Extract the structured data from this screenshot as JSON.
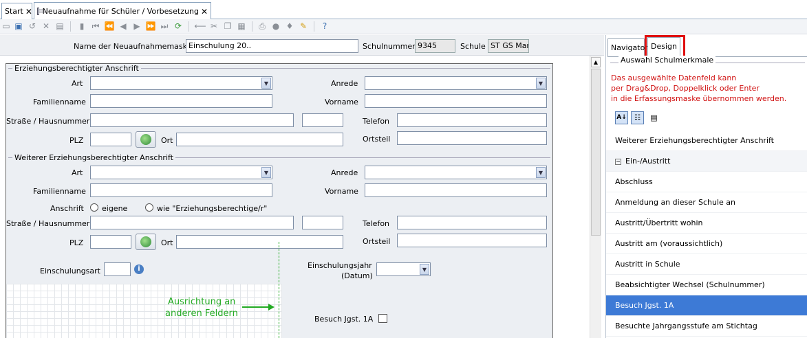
{
  "tabs": [
    {
      "label": "Start"
    },
    {
      "label": "Neuaufnahme für Schüler / Vorbesetzung"
    }
  ],
  "close_glyph": "✕",
  "header": {
    "name_label": "Name der Neuaufnahmemaske",
    "name_value": "Einschulung 20..",
    "schulnummer_label": "Schulnummer",
    "schulnummer_value": "9345",
    "schule_label": "Schule",
    "schule_value": "ST GS Mark"
  },
  "group1": {
    "title": "Erziehungsberechtigter Anschrift",
    "art": "Art",
    "anrede": "Anrede",
    "familienname": "Familienname",
    "vorname": "Vorname",
    "strasse": "Straße / Hausnummer",
    "telefon": "Telefon",
    "plz": "PLZ",
    "ort": "Ort",
    "ortsteil": "Ortsteil"
  },
  "group2": {
    "title": "Weiterer Erziehungsberechtigter Anschrift",
    "art": "Art",
    "anrede": "Anrede",
    "familienname": "Familienname",
    "vorname": "Vorname",
    "anschrift": "Anschrift",
    "opt1": "eigene",
    "opt2": "wie \"Erziehungsberechtige/r\"",
    "strasse": "Straße / Hausnummer",
    "telefon": "Telefon",
    "plz": "PLZ",
    "ort": "Ort",
    "ortsteil": "Ortsteil"
  },
  "einschulungsart": "Einschulungsart",
  "einschulungsjahr_l1": "Einschulungsjahr",
  "einschulungsjahr_l2": "(Datum)",
  "annotation_l1": "Ausrichtung an",
  "annotation_l2": "anderen Feldern",
  "besuch_label": "Besuch Jgst. 1A",
  "right": {
    "tab_navigator": "Navigator",
    "tab_design": "Design",
    "section": "Auswahl Schulmerkmale",
    "hint_l1": "Das ausgewählte Datenfeld kann",
    "hint_l2": "per Drag&Drop, Doppelklick oder Enter",
    "hint_l3": "in die Erfassungsmaske übernommen werden.",
    "items": [
      {
        "label": "Weiterer Erziehungsberechtigter Anschrift"
      },
      {
        "label": "Ein-/Austritt",
        "group": true
      },
      {
        "label": "Abschluss"
      },
      {
        "label": "Anmeldung an dieser Schule an"
      },
      {
        "label": "Austritt/Übertritt wohin"
      },
      {
        "label": "Austritt am (voraussichtlich)"
      },
      {
        "label": "Austritt in Schule"
      },
      {
        "label": "Beabsichtigter Wechsel (Schulnummer)"
      },
      {
        "label": "Besuch Jgst. 1A",
        "selected": true
      },
      {
        "label": "Besuchte Jahrgangsstufe am Stichtag"
      }
    ]
  },
  "colors": {
    "accent": "#3d7ad6",
    "hint": "#d01010",
    "annotation": "#22aa22",
    "highlight": "#e01010"
  }
}
